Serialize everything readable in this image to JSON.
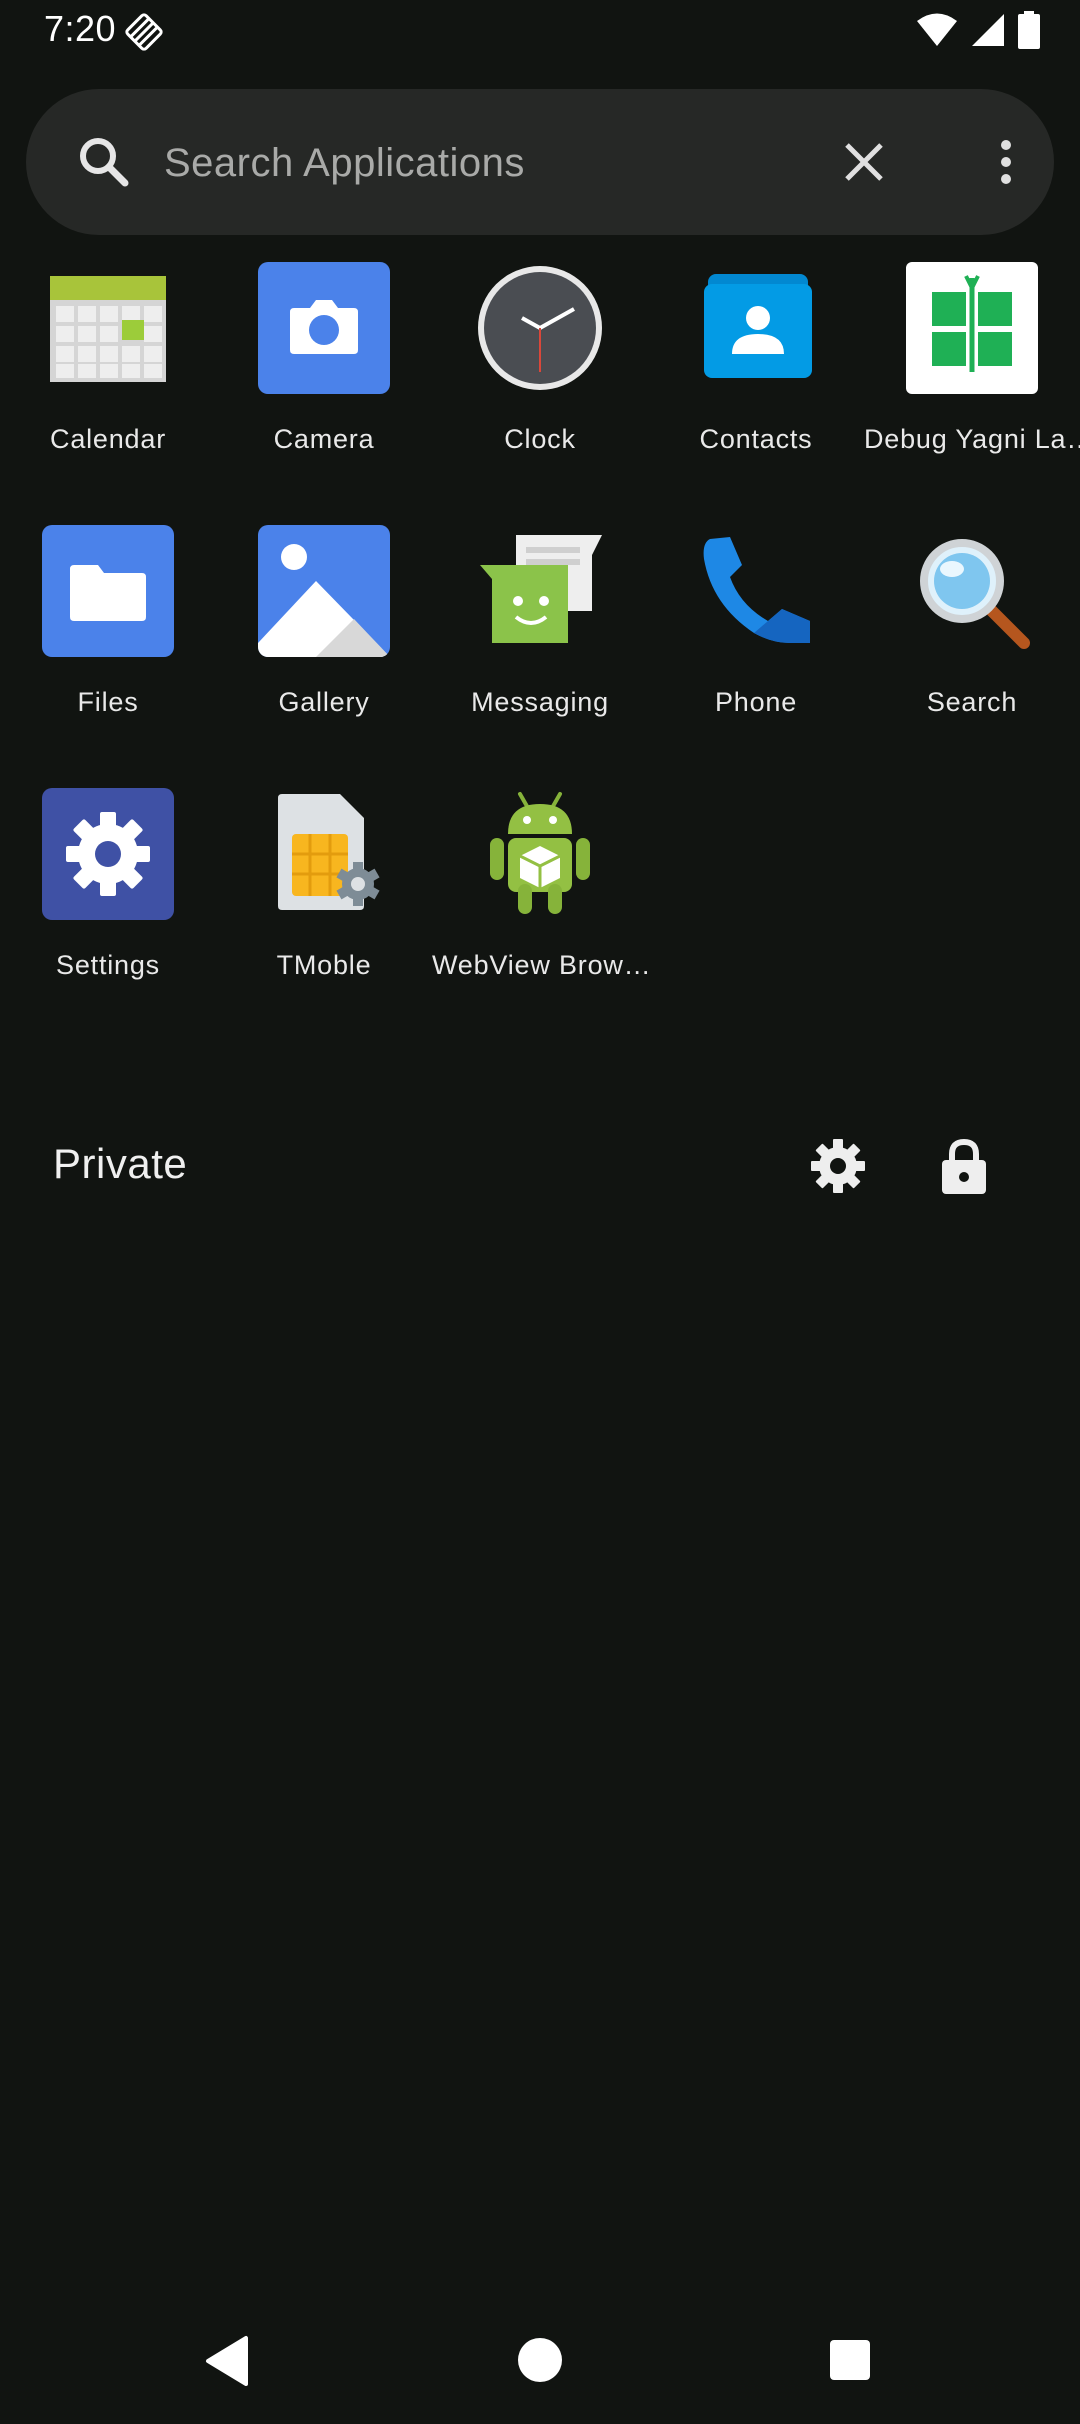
{
  "status_bar": {
    "time": "7:20",
    "icons": [
      "notification-diamond-icon",
      "wifi-icon",
      "cell-signal-icon",
      "battery-icon"
    ]
  },
  "search": {
    "placeholder": "Search Applications",
    "icon": "search-icon",
    "clear_icon": "close-icon",
    "menu_icon": "more-vert-icon"
  },
  "apps": [
    {
      "label": "Calendar",
      "icon": "calendar-icon"
    },
    {
      "label": "Camera",
      "icon": "camera-icon"
    },
    {
      "label": "Clock",
      "icon": "clock-icon"
    },
    {
      "label": "Contacts",
      "icon": "contacts-icon"
    },
    {
      "label": "Debug Yagni La…",
      "icon": "yagni-icon"
    },
    {
      "label": "Files",
      "icon": "files-icon"
    },
    {
      "label": "Gallery",
      "icon": "gallery-icon"
    },
    {
      "label": "Messaging",
      "icon": "messaging-icon"
    },
    {
      "label": "Phone",
      "icon": "phone-icon"
    },
    {
      "label": "Search",
      "icon": "magnifier-icon"
    },
    {
      "label": "Settings",
      "icon": "settings-icon"
    },
    {
      "label": "TMoble",
      "icon": "sim-settings-icon"
    },
    {
      "label": "WebView Brow…",
      "icon": "android-icon"
    }
  ],
  "private_space": {
    "label": "Private",
    "settings_icon": "gear-icon",
    "lock_icon": "lock-icon"
  },
  "nav_bar": {
    "icons": [
      "back-icon",
      "home-icon",
      "recents-icon"
    ]
  },
  "colors": {
    "background": "#111411",
    "search_bar": "#262826",
    "text": "#e9e9e9"
  }
}
